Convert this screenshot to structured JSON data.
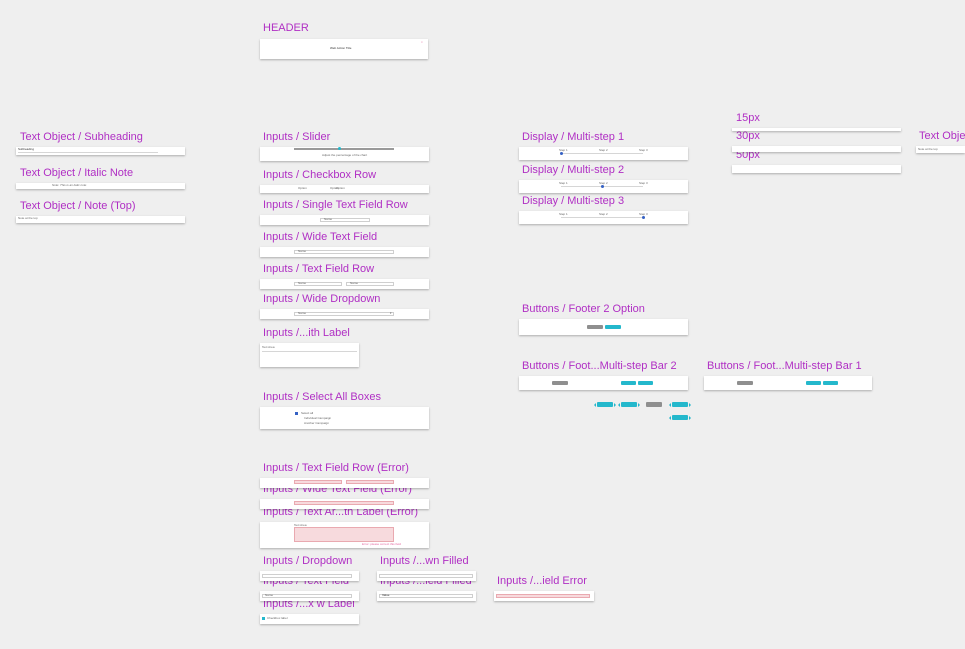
{
  "labels": {
    "header": "HEADER",
    "subheading": "Text Object / Subheading",
    "italic_note": "Text Object / Italic Note",
    "note_top": "Text Object / Note (Top)",
    "slider": "Inputs / Slider",
    "checkbox_row": "Inputs / Checkbox Row",
    "single_text_field_row": "Inputs / Single Text Field Row",
    "wide_text_field": "Inputs / Wide Text Field",
    "text_field_row": "Inputs / Text Field Row",
    "wide_dropdown": "Inputs / Wide Dropdown",
    "with_label": "Inputs /...ith Label",
    "select_all_boxes": "Inputs / Select All Boxes",
    "text_field_row_error": "Inputs / Text Field Row (Error)",
    "wide_text_field_error": "Inputs / Wide Text Field (Error)",
    "text_area_label_error": "Inputs / Text Ar...th Label (Error)",
    "dropdown": "Inputs / Dropdown",
    "text_field": "Inputs / Text Field",
    "checkbox_w_label": "Inputs /...x w Label",
    "dropdown_filled": "Inputs /...wn Filled",
    "field_filled": "Inputs /...ield Filled",
    "field_error": "Inputs /...ield Error",
    "multistep_1": "Display / Multi-step 1",
    "multistep_2": "Display / Multi-step 2",
    "multistep_3": "Display / Multi-step 3",
    "footer_2_option": "Buttons / Footer 2 Option",
    "footer_multistep_2": "Buttons / Foot...Multi-step Bar 2",
    "footer_multistep_1": "Buttons / Foot...Multi-step Bar 1",
    "spacer_15": "15px",
    "spacer_30": "30px",
    "spacer_50": "50px",
    "text_obj_cut": "Text Obje"
  },
  "artboards": {
    "header_title": "Web Action Title",
    "slider_caption": "Adjust the percentage of the chart",
    "checkbox_options": [
      "Option",
      "Option",
      "Option"
    ],
    "field_placeholder": "Name",
    "field_value": "Value",
    "select_all": "Select all",
    "sub_options": [
      "Individual Campaign",
      "Another Campaign"
    ],
    "step_labels": [
      "Step 1",
      "Step 2",
      "Step 3"
    ],
    "checkbox_label": "Checkbox label",
    "subheading_text": "Subheading",
    "note_text": "Note: This is an italic note",
    "note_top_text": "Note at the top",
    "text_area_label": "Text Area",
    "error_hint": "Error: please correct this field"
  },
  "colors": {
    "label": "#b02fc4",
    "accent": "#24b8cc",
    "secondary": "#8f8f8f",
    "error_fill": "#f7dadd",
    "progress": "#3561c4"
  },
  "slider_value": 0.45,
  "active_steps": {
    "multistep_1": 1,
    "multistep_2": 2,
    "multistep_3": 3
  }
}
